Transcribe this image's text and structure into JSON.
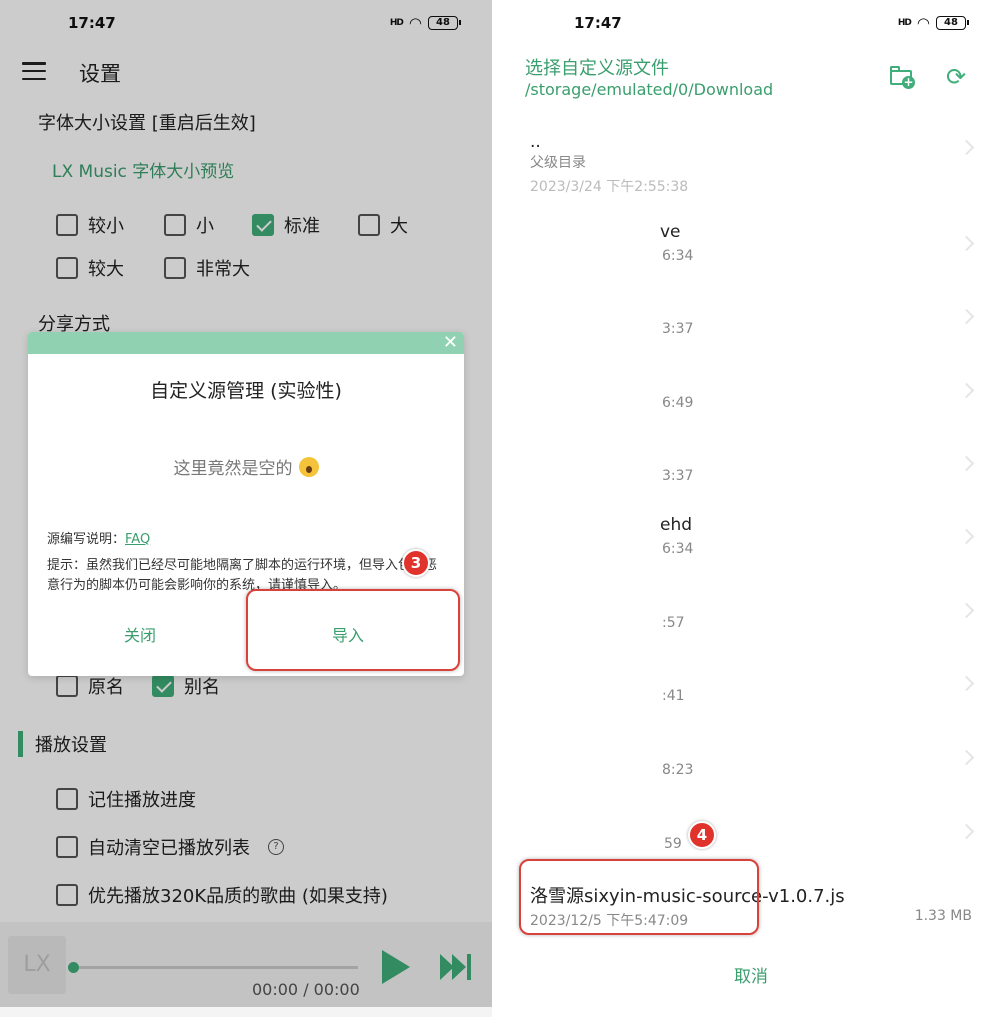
{
  "status": {
    "time": "17:47",
    "signal": "HD",
    "battery": "48"
  },
  "settings": {
    "title": "设置",
    "font_size_label": "字体大小设置 [重启后生效]",
    "preview": "LX Music 字体大小预览",
    "font_options": [
      {
        "label": "较小",
        "checked": false
      },
      {
        "label": "小",
        "checked": false
      },
      {
        "label": "标准",
        "checked": true
      },
      {
        "label": "大",
        "checked": false
      },
      {
        "label": "较大",
        "checked": false
      },
      {
        "label": "非常大",
        "checked": false
      }
    ],
    "share_label": "分享方式",
    "name_options": [
      {
        "label": "原名",
        "checked": false
      },
      {
        "label": "别名",
        "checked": true
      }
    ],
    "play_section": "播放设置",
    "play_options": [
      {
        "label": "记住播放进度",
        "checked": false
      },
      {
        "label": "自动清空已播放列表",
        "checked": false
      },
      {
        "label": "优先播放320K品质的歌曲 (如果支持)",
        "checked": false
      }
    ],
    "help_icon": "?"
  },
  "player": {
    "art_text": "LX",
    "time": "00:00 / 00:00"
  },
  "dialog": {
    "close_icon": "✕",
    "title": "自定义源管理 (实验性)",
    "empty_text": "这里竟然是空的",
    "faq_prefix": "源编写说明：",
    "faq_link": "FAQ",
    "tip": "提示：虽然我们已经尽可能地隔离了脚本的运行环境，但导入包含恶意行为的脚本仍可能会影响你的系统，请谨慎导入。",
    "close_button": "关闭",
    "import_button": "导入"
  },
  "steps": {
    "three": "3",
    "four": "4"
  },
  "picker": {
    "title": "选择自定义源文件",
    "path": "/storage/emulated/0/Download",
    "refresh_icon": "⟳",
    "plus_icon": "+",
    "files": [
      {
        "name": "..",
        "date": "父级目录"
      },
      {
        "name": "",
        "date": "2023/3/24 下午2:55:38"
      },
      {
        "name": "ve",
        "date": "6:34"
      },
      {
        "name": "",
        "date": "3:37"
      },
      {
        "name": "",
        "date": "6:49"
      },
      {
        "name": "",
        "date": "3:37"
      },
      {
        "name": "ehd",
        "date": "6:34"
      },
      {
        "name": "",
        "date": ":57"
      },
      {
        "name": "",
        "date": ":41"
      },
      {
        "name": "",
        "date": "8:23"
      },
      {
        "name": "",
        "date": "59"
      }
    ],
    "selected_file": {
      "name": "洛雪源sixyin-music-source-v1.0.7.js",
      "date": "2023/12/5 下午5:47:09",
      "size": "1.33 MB"
    },
    "cancel_button": "取消"
  }
}
